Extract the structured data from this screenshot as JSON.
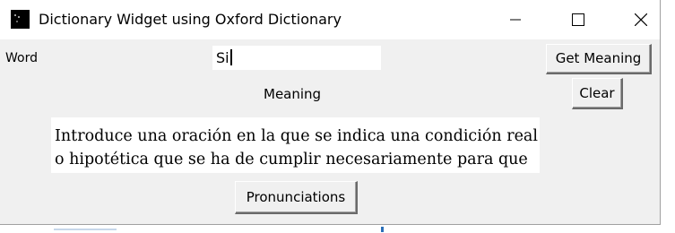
{
  "window": {
    "title": "Dictionary Widget using Oxford Dictionary",
    "icons": [
      "app-icon",
      "minimize-icon",
      "maximize-icon",
      "close-icon"
    ]
  },
  "form": {
    "word_label": "Word",
    "word_value": "Si",
    "get_meaning_label": "Get Meaning",
    "meaning_label": "Meaning",
    "clear_label": "Clear",
    "meaning_lines": [
      "Introduce una oración en la que se indica una condición real",
      "o hipotética que se ha de cumplir necesariamente para que"
    ],
    "pronunciations_label": "Pronunciations"
  },
  "colors": {
    "window_bg": "#f0f0f0",
    "titlebar_bg": "#ffffff",
    "text_bg": "#ffffff"
  }
}
